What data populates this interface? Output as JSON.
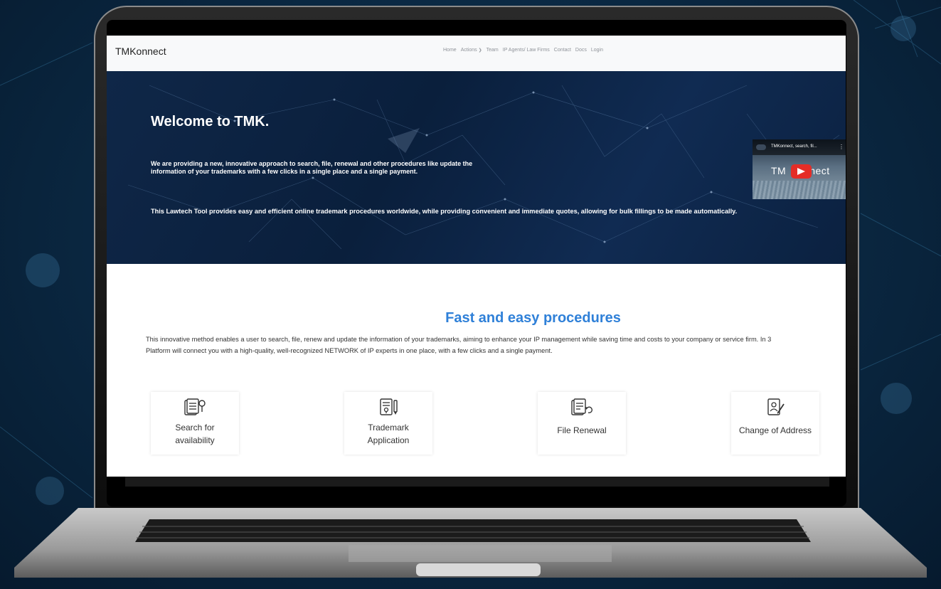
{
  "nav": {
    "brand": "TMKonnect",
    "links": [
      "Home",
      "Actions",
      "Team",
      "IP Agents/ Law Firms",
      "Contact",
      "Docs",
      "Login"
    ]
  },
  "hero": {
    "title": "Welcome to TMK.",
    "paragraph1_line1": "We are providing a new, innovative approach to search, file, renewal and other procedures like update the",
    "paragraph1_line2": "information of your trademarks with a few clicks in a single place and a single payment.",
    "paragraph2": "This Lawtech Tool provides easy and efficient online trademark procedures worldwide, while providing convenient and immediate quotes, allowing for bulk fillings to be made automatically.",
    "video": {
      "title": "TMKonnect, search, fil...",
      "brand_left": "TM",
      "brand_right": "nect"
    }
  },
  "procedures": {
    "title": "Fast and easy procedures",
    "text_line1": "This innovative method enables a user to search, file, renew and update the information of your trademarks, aiming to enhance your IP management while saving time and costs to your company or service firm. In 3",
    "text_line2": "Platform will connect you with a high-quality, well-recognized NETWORK of IP experts in one place, with a few clicks and a single payment.",
    "cards": [
      {
        "label_line1": "Search for",
        "label_line2": "availability",
        "icon": "document-search-icon"
      },
      {
        "label_line1": "Trademark",
        "label_line2": "Application",
        "icon": "document-pen-icon"
      },
      {
        "label_line1": "File Renewal",
        "label_line2": "",
        "icon": "document-renew-icon"
      },
      {
        "label_line1": "Change of Address",
        "label_line2": "",
        "icon": "address-edit-icon"
      }
    ]
  }
}
